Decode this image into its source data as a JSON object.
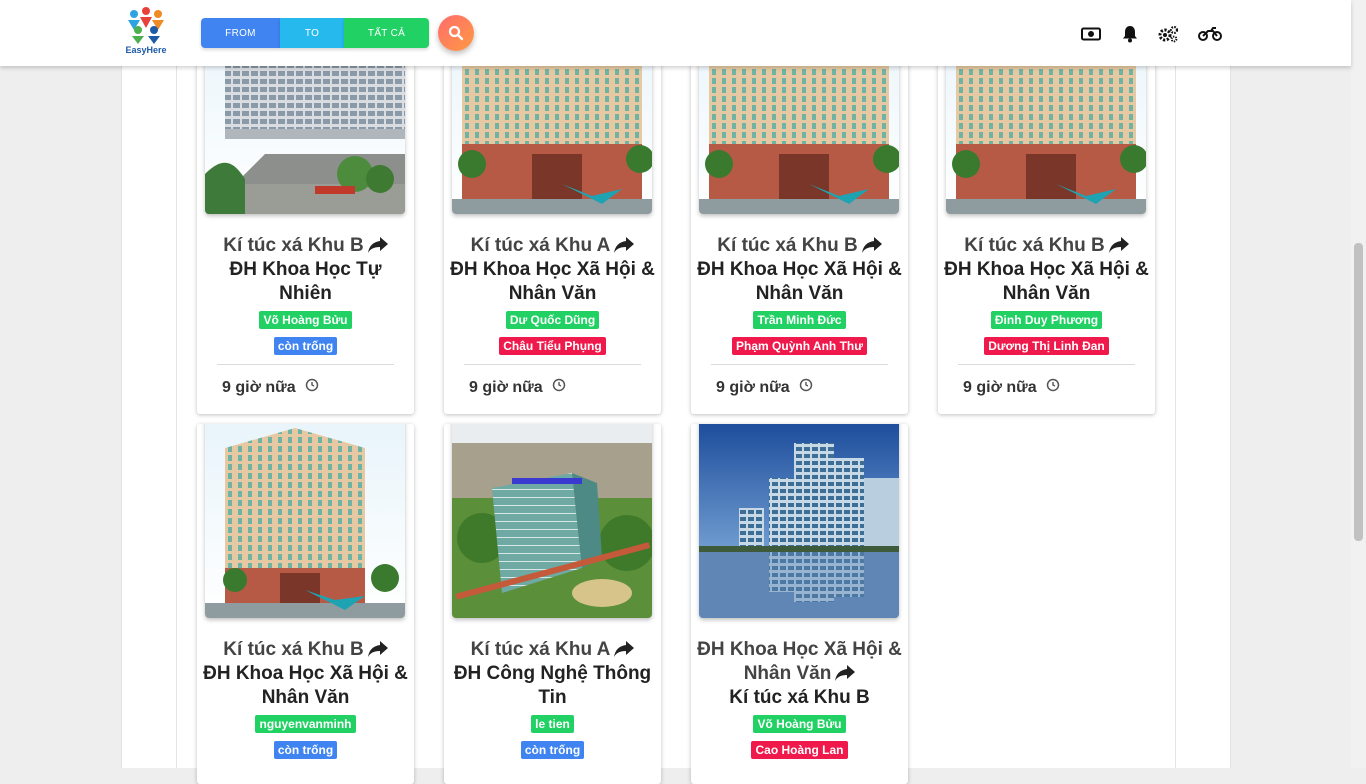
{
  "header": {
    "logo_text": "EasyHere",
    "buttons": {
      "from": "FROM",
      "to": "TO",
      "all": "TẤT CẢ"
    }
  },
  "colors": {
    "from": "#3f84f1",
    "to": "#25b9ee",
    "all": "#21d164",
    "badge_red": "#f0194b"
  },
  "icons": [
    "search-icon",
    "money-icon",
    "bell-icon",
    "gears-icon",
    "motorcycle-icon",
    "share-arrow-icon",
    "clock-icon"
  ],
  "cards": [
    {
      "line1": "Kí túc xá Khu B",
      "line2": "ĐH Khoa Học Tự Nhiên",
      "user": "Võ Hoàng Bửu",
      "status": "còn trống",
      "time": "9 giờ nữa"
    },
    {
      "line1": "Kí túc xá Khu A",
      "line2": "ĐH Khoa Học Xã Hội & Nhân Văn",
      "user": "Dư Quốc Dũng",
      "status": "Châu Tiểu Phụng",
      "time": "9 giờ nữa"
    },
    {
      "line1": "Kí túc xá Khu B",
      "line2": "ĐH Khoa Học Xã Hội & Nhân Văn",
      "user": "Trần Minh Đức",
      "status": "Phạm Quỳnh Anh Thư",
      "time": "9 giờ nữa"
    },
    {
      "line1": "Kí túc xá Khu B",
      "line2": "ĐH Khoa Học Xã Hội & Nhân Văn",
      "user": "Đinh Duy Phương",
      "status": "Dương Thị Linh Đan",
      "time": "9 giờ nữa"
    },
    {
      "line1": "Kí túc xá Khu B",
      "line2": "ĐH Khoa Học Xã Hội & Nhân Văn",
      "user": "nguyenvanminh",
      "status": "còn trống"
    },
    {
      "line1": "Kí túc xá Khu A",
      "line2": "ĐH Công Nghệ Thông Tin",
      "user": "le tien",
      "status": "còn trống"
    },
    {
      "line1": "ĐH Khoa Học Xã Hội & Nhân Văn",
      "line2": "Kí túc xá Khu B",
      "user": "Võ Hoàng Bửu",
      "status": "Cao Hoàng Lan"
    }
  ]
}
